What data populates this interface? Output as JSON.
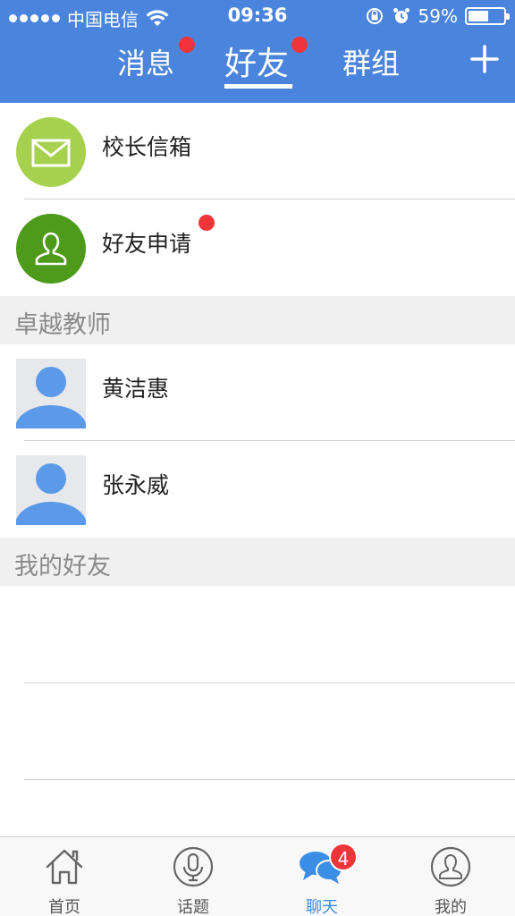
{
  "status_bar": {
    "carrier": "中国电信",
    "time": "09:36",
    "battery": "59%",
    "battery_level": 0.59
  },
  "header": {
    "tabs": [
      {
        "label": "消息",
        "active": false,
        "has_dot": true
      },
      {
        "label": "好友",
        "active": true,
        "has_dot": true
      },
      {
        "label": "群组",
        "active": false,
        "has_dot": false
      }
    ],
    "add_icon": "plus-icon"
  },
  "entries": [
    {
      "label": "校长信箱",
      "icon": "mail-icon",
      "color": "#a6d14f",
      "has_dot": false
    },
    {
      "label": "好友申请",
      "icon": "person-outline-icon",
      "color": "#4e9a1a",
      "has_dot": true
    }
  ],
  "sections": [
    {
      "title": "卓越教师",
      "contacts": [
        {
          "name": "黄洁惠"
        },
        {
          "name": "张永威"
        }
      ]
    },
    {
      "title": "我的好友",
      "contacts": []
    }
  ],
  "bottom_nav": [
    {
      "label": "首页",
      "icon": "home-icon",
      "active": false
    },
    {
      "label": "话题",
      "icon": "microphone-icon",
      "active": false
    },
    {
      "label": "聊天",
      "icon": "chat-bubbles-icon",
      "active": true,
      "badge": "4"
    },
    {
      "label": "我的",
      "icon": "user-profile-icon",
      "active": false
    }
  ],
  "colors": {
    "header_bg": "#4a84dd",
    "badge_red": "#f0353a",
    "active_blue": "#3a8ee6",
    "avatar_blue": "#5b9ae8"
  }
}
